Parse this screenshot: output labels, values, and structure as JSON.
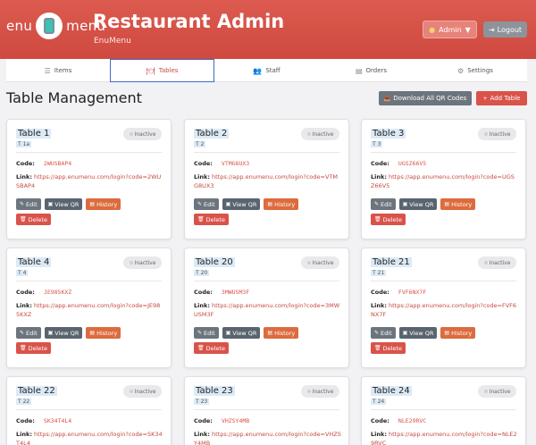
{
  "header": {
    "logo_left": "enu",
    "logo_right": "menu",
    "title": "Restaurant Admin",
    "subtitle": "EnuMenu",
    "admin_label": "Admin",
    "logout_label": "Logout"
  },
  "nav": {
    "tabs": [
      {
        "label": "Items",
        "icon": "list-icon"
      },
      {
        "label": "Tables",
        "icon": "table-icon"
      },
      {
        "label": "Staff",
        "icon": "users-icon"
      },
      {
        "label": "Orders",
        "icon": "receipt-icon"
      },
      {
        "label": "Settings",
        "icon": "gear-icon"
      }
    ],
    "active": "Tables"
  },
  "page": {
    "title": "Table Management",
    "download_label": "Download All QR Codes",
    "add_label": "Add Table"
  },
  "labels": {
    "code": "Code:",
    "link": "Link:",
    "edit": "Edit",
    "view_qr": "View QR",
    "history": "History",
    "delete": "Delete"
  },
  "tables": [
    {
      "name": "Table 1",
      "number": "T 1a",
      "status": "Inactive",
      "code": "2WUSBAP4",
      "link": "https://app.enumenu.com/login?code=2WUSBAP4"
    },
    {
      "name": "Table 2",
      "number": "T 2",
      "status": "Inactive",
      "code": "VTMG8UX3",
      "link": "https://app.enumenu.com/login?code=VTMG8UX3"
    },
    {
      "name": "Table 3",
      "number": "T 3",
      "status": "Inactive",
      "code": "UGSZ66V5",
      "link": "https://app.enumenu.com/login?code=UGSZ66V5"
    },
    {
      "name": "Table 4",
      "number": "T 4",
      "status": "Inactive",
      "code": "JE985KXZ",
      "link": "https://app.enumenu.com/login?code=JE985KXZ"
    },
    {
      "name": "Table 20",
      "number": "T 20",
      "status": "Inactive",
      "code": "3MWUSM3F",
      "link": "https://app.enumenu.com/login?code=3MWUSM3F"
    },
    {
      "name": "Table 21",
      "number": "T 21",
      "status": "Inactive",
      "code": "FVF6NX7F",
      "link": "https://app.enumenu.com/login?code=FVF6NX7F"
    },
    {
      "name": "Table 22",
      "number": "T 22",
      "status": "Inactive",
      "code": "SK34T4L4",
      "link": "https://app.enumenu.com/login?code=SK34T4L4"
    },
    {
      "name": "Table 23",
      "number": "T 23",
      "status": "Inactive",
      "code": "VHZSY4MB",
      "link": "https://app.enumenu.com/login?code=VHZSY4MB"
    },
    {
      "name": "Table 24",
      "number": "T 24",
      "status": "Inactive",
      "code": "NLE29RVC",
      "link": "https://app.enumenu.com/login?code=NLE29RVC"
    }
  ],
  "colors": {
    "brand": "#d9534a",
    "link": "#c44a40",
    "secondary": "#6c757d"
  }
}
